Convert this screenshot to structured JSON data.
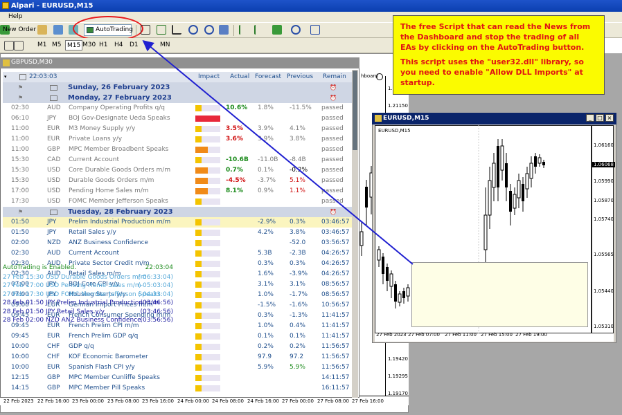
{
  "app": {
    "title": "Alpari - EURUSD,M15",
    "menu_help": "Help"
  },
  "toolbar": {
    "new_order": "New Order",
    "autotrading": "AutoTrading"
  },
  "timeframes": [
    "M1",
    "M5",
    "M15",
    "M30",
    "H1",
    "H4",
    "D1",
    "MN"
  ],
  "news": {
    "window_title": "GBPUSD,M30",
    "clock": "22:03:03",
    "headers": {
      "impact": "Impact",
      "actual": "Actual",
      "forecast": "Forecast",
      "previous": "Previous",
      "remain": "Remain"
    },
    "rows": [
      {
        "type": "date",
        "text": "Sunday, 26 February 2023"
      },
      {
        "type": "date",
        "text": "Monday, 27 February 2023"
      },
      {
        "time": "02:30",
        "cur": "AUD",
        "event": "Company Operating Profits q/q",
        "impact": "low",
        "actual": "10.6%",
        "actual_color": "#1a8a1a",
        "forecast": "1.8%",
        "previous": "-11.5%",
        "remain": "passed"
      },
      {
        "time": "06:10",
        "cur": "JPY",
        "event": "BOJ Gov-Designate Ueda Speaks",
        "impact": "high",
        "actual": "",
        "forecast": "",
        "previous": "",
        "remain": "passed"
      },
      {
        "time": "11:00",
        "cur": "EUR",
        "event": "M3 Money Supply y/y",
        "impact": "low",
        "actual": "3.5%",
        "actual_color": "#d01010",
        "forecast": "3.9%",
        "previous": "4.1%",
        "remain": "passed"
      },
      {
        "time": "11:00",
        "cur": "EUR",
        "event": "Private Loans y/y",
        "impact": "low",
        "actual": "3.6%",
        "actual_color": "#d01010",
        "forecast": "3.9%",
        "previous": "3.8%",
        "remain": "passed"
      },
      {
        "time": "11:00",
        "cur": "GBP",
        "event": "MPC Member Broadbent Speaks",
        "impact": "med",
        "actual": "",
        "forecast": "",
        "previous": "",
        "remain": "passed"
      },
      {
        "time": "15:30",
        "cur": "CAD",
        "event": "Current Account",
        "impact": "low",
        "actual": "-10.6B",
        "actual_color": "#1a8a1a",
        "forecast": "-11.0B",
        "previous": "-8.4B",
        "remain": "passed"
      },
      {
        "time": "15:30",
        "cur": "USD",
        "event": "Core Durable Goods Orders m/m",
        "impact": "med",
        "actual": "0.7%",
        "actual_color": "#1a8a1a",
        "forecast": "0.1%",
        "previous": "-0.2%",
        "previous_color": "#000000",
        "remain": "passed"
      },
      {
        "time": "15:30",
        "cur": "USD",
        "event": "Durable Goods Orders m/m",
        "impact": "med",
        "actual": "-4.5%",
        "actual_color": "#d01010",
        "forecast": "-3.7%",
        "previous": "5.1%",
        "previous_color": "#d01010",
        "remain": "passed"
      },
      {
        "time": "17:00",
        "cur": "USD",
        "event": "Pending Home Sales m/m",
        "impact": "med",
        "actual": "8.1%",
        "actual_color": "#1a8a1a",
        "forecast": "0.9%",
        "previous": "1.1%",
        "previous_color": "#d01010",
        "remain": "passed"
      },
      {
        "time": "17:30",
        "cur": "USD",
        "event": "FOMC Member Jefferson Speaks",
        "impact": "low",
        "actual": "",
        "forecast": "",
        "previous": "",
        "remain": "passed"
      },
      {
        "type": "date",
        "text": "Tuesday, 28 February 2023"
      },
      {
        "time": "01:50",
        "cur": "JPY",
        "event": "Prelim Industrial Production m/m",
        "impact": "low",
        "actual": "",
        "forecast": "-2.9%",
        "previous": "0.3%",
        "remain": "03:46:57",
        "hl": true
      },
      {
        "time": "01:50",
        "cur": "JPY",
        "event": "Retail Sales y/y",
        "impact": "low",
        "actual": "",
        "forecast": "4.2%",
        "previous": "3.8%",
        "remain": "03:46:57"
      },
      {
        "time": "02:00",
        "cur": "NZD",
        "event": "ANZ Business Confidence",
        "impact": "low",
        "actual": "",
        "forecast": "",
        "previous": "-52.0",
        "remain": "03:56:57"
      },
      {
        "time": "02:30",
        "cur": "AUD",
        "event": "Current Account",
        "impact": "low",
        "actual": "",
        "forecast": "5.3B",
        "previous": "-2.3B",
        "remain": "04:26:57"
      },
      {
        "time": "02:30",
        "cur": "AUD",
        "event": "Private Sector Credit m/m",
        "impact": "low",
        "actual": "",
        "forecast": "0.3%",
        "previous": "0.3%",
        "remain": "04:26:57"
      },
      {
        "time": "02:30",
        "cur": "AUD",
        "event": "Retail Sales m/m",
        "impact": "low",
        "actual": "",
        "forecast": "1.6%",
        "previous": "-3.9%",
        "remain": "04:26:57"
      },
      {
        "time": "07:00",
        "cur": "JPY",
        "event": "BOJ Core CPI y/y",
        "impact": "low",
        "actual": "",
        "forecast": "3.1%",
        "previous": "3.1%",
        "remain": "08:56:57"
      },
      {
        "time": "07:00",
        "cur": "JPY",
        "event": "Housing Starts y/y",
        "impact": "low",
        "actual": "",
        "forecast": "1.0%",
        "previous": "-1.7%",
        "remain": "08:56:57"
      },
      {
        "time": "09:00",
        "cur": "EUR",
        "event": "German Import Prices m/m",
        "impact": "low",
        "actual": "",
        "forecast": "-1.5%",
        "previous": "-1.6%",
        "remain": "10:56:57"
      },
      {
        "time": "09:45",
        "cur": "EUR",
        "event": "French Consumer Spending m/m",
        "impact": "low",
        "actual": "",
        "forecast": "0.3%",
        "previous": "-1.3%",
        "remain": "11:41:57"
      },
      {
        "time": "09:45",
        "cur": "EUR",
        "event": "French Prelim CPI m/m",
        "impact": "low",
        "actual": "",
        "forecast": "1.0%",
        "previous": "0.4%",
        "remain": "11:41:57"
      },
      {
        "time": "09:45",
        "cur": "EUR",
        "event": "French Prelim GDP q/q",
        "impact": "low",
        "actual": "",
        "forecast": "0.1%",
        "previous": "0.1%",
        "remain": "11:41:57"
      },
      {
        "time": "10:00",
        "cur": "CHF",
        "event": "GDP q/q",
        "impact": "low",
        "actual": "",
        "forecast": "0.2%",
        "previous": "0.2%",
        "remain": "11:56:57"
      },
      {
        "time": "10:00",
        "cur": "CHF",
        "event": "KOF Economic Barometer",
        "impact": "low",
        "actual": "",
        "forecast": "97.9",
        "previous": "97.2",
        "remain": "11:56:57"
      },
      {
        "time": "10:00",
        "cur": "EUR",
        "event": "Spanish Flash CPI y/y",
        "impact": "low",
        "actual": "",
        "forecast": "5.9%",
        "previous": "5.9%",
        "previous_color": "#1a8a1a",
        "remain": "11:56:57"
      },
      {
        "time": "12:15",
        "cur": "GBP",
        "event": "MPC Member Cunliffe Speaks",
        "impact": "low",
        "actual": "",
        "forecast": "",
        "previous": "",
        "remain": "14:11:57"
      },
      {
        "time": "14:15",
        "cur": "GBP",
        "event": "MPC Member Pill Speaks",
        "impact": "low",
        "actual": "",
        "forecast": "",
        "previous": "",
        "remain": "16:11:57"
      }
    ]
  },
  "background_chart": {
    "price_labels": [
      "1.21350",
      "1.21150",
      "1.19420",
      "1.19295",
      "1.19170"
    ],
    "time_labels": [
      "22 Feb 2023",
      "22 Feb 16:00",
      "23 Feb 00:00",
      "23 Feb 08:00",
      "23 Feb 16:00",
      "24 Feb 00:00",
      "24 Feb 08:00",
      "24 Feb 16:00",
      "27 Feb 00:00",
      "27 Feb 08:00",
      "27 Feb 16:00"
    ],
    "partial_label": "hboard"
  },
  "annotation": {
    "p1": "The free Script that can read the News from the Dashboard and stop the trading of all EAs by clicking on the AutoTrading button.",
    "p2": "This script uses the \"user32.dll\" library, so you need to enable \"Allow DLL Imports\" at startup."
  },
  "eur_window": {
    "title": "EURUSD,M15",
    "symbol_label": "EURUSD,M15",
    "price_labels": [
      "1.06160",
      "1.06068",
      "1.05990",
      "1.05870",
      "1.05740",
      "1.05565",
      "1.05440",
      "1.05310"
    ],
    "current_price": "1.06068",
    "time_labels": [
      "27 Feb 2023",
      "27 Feb 07:00",
      "27 Feb 11:00",
      "27 Feb 15:00",
      "27 Feb 19:00"
    ]
  },
  "status": {
    "header": "AutoTrading is Enabled.",
    "clock": "22:03:04",
    "rows": [
      {
        "date": "27 Feb",
        "time": "15:30",
        "text": "USD Durable Goods Orders m/m",
        "remain": "(-06:33:04)",
        "past": true
      },
      {
        "date": "27 Feb",
        "time": "17:00",
        "text": "USD Pending Home Sales m/m",
        "remain": "(-05:03:04)",
        "past": true
      },
      {
        "date": "27 Feb",
        "time": "17:30",
        "text": "USD FOMC Member Jefferson Speaks",
        "remain": "(-04:33:04)",
        "past": true
      },
      {
        "date": "28 Feb",
        "time": "01:50",
        "text": "JPY Prelim Industrial Production m/m",
        "remain": "(03:46:56)",
        "past": false
      },
      {
        "date": "28 Feb",
        "time": "01:50",
        "text": "JPY Retail Sales y/y",
        "remain": "(03:46:56)",
        "past": false
      },
      {
        "date": "28 Feb",
        "time": "02:00",
        "text": "NZD ANZ Business Confidence",
        "remain": "(03:56:56)",
        "past": false
      }
    ]
  },
  "colors": {
    "accent": "#1e53c9",
    "annotation_bg": "#fbfb00",
    "annotation_text": "#e01313",
    "arrow": "#2020d0",
    "oval": "#e8191c",
    "impact_low": "#f4c400",
    "impact_med": "#f08a18",
    "impact_high": "#e8283a",
    "status_green": "#1a8a1a",
    "status_past": "#55a8d8",
    "status_future": "#1a1aa0"
  }
}
